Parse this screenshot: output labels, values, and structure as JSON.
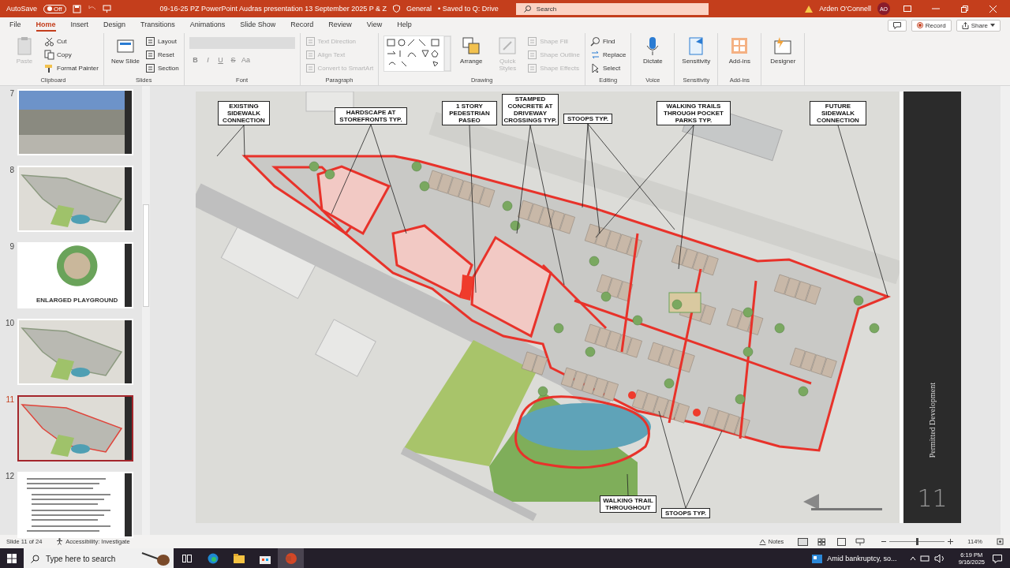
{
  "title_bar": {
    "autosave_label": "AutoSave",
    "autosave": {
      "label": "Off",
      "on": false
    },
    "filename": "09-16-25 PZ PowerPoint Audras presentation 13 September 2025 P & Z",
    "sensitivity": "General",
    "save_status": "• Saved to Q: Drive",
    "search": {
      "placeholder": "Search"
    },
    "user": "Arden O'Connell",
    "avatar": "AO"
  },
  "tabs": [
    {
      "label": "File",
      "selected": false
    },
    {
      "label": "Home",
      "selected": true
    },
    {
      "label": "Insert",
      "selected": false
    },
    {
      "label": "Design",
      "selected": false
    },
    {
      "label": "Transitions",
      "selected": false
    },
    {
      "label": "Animations",
      "selected": false
    },
    {
      "label": "Slide Show",
      "selected": false
    },
    {
      "label": "Record",
      "selected": false
    },
    {
      "label": "Review",
      "selected": false
    },
    {
      "label": "View",
      "selected": false
    },
    {
      "label": "Help",
      "selected": false
    }
  ],
  "ribbon_actions": {
    "record": "Record",
    "share": "Share"
  },
  "ribbon": {
    "groups": [
      {
        "label": "Clipboard",
        "items": [
          {
            "label": "Paste",
            "kind": "large",
            "disabled": true
          },
          {
            "label": "Cut",
            "kind": "small",
            "disabled": false
          },
          {
            "label": "Copy",
            "kind": "small",
            "disabled": false
          },
          {
            "label": "Format Painter",
            "kind": "small",
            "disabled": false
          }
        ]
      },
      {
        "label": "Slides",
        "items": [
          {
            "label": "New Slide",
            "kind": "large",
            "disabled": false
          },
          {
            "label": "Layout",
            "kind": "small",
            "disabled": false
          },
          {
            "label": "Reset",
            "kind": "small",
            "disabled": false
          },
          {
            "label": "Section",
            "kind": "small",
            "disabled": false
          }
        ]
      },
      {
        "label": "Font",
        "items": [
          {
            "kind": "field",
            "disabled": true
          },
          {
            "label": "B",
            "kind": "glyph",
            "disabled": true
          },
          {
            "label": "I",
            "kind": "glyph",
            "disabled": true
          },
          {
            "label": "U",
            "kind": "glyph",
            "disabled": true
          },
          {
            "label": "S",
            "kind": "glyph",
            "disabled": true
          },
          {
            "label": "Aa",
            "kind": "glyph",
            "disabled": true
          }
        ]
      },
      {
        "label": "Paragraph",
        "items": [
          {
            "label": "Text Direction",
            "kind": "small",
            "disabled": true
          },
          {
            "label": "Align Text",
            "kind": "small",
            "disabled": true
          },
          {
            "label": "Convert to SmartArt",
            "kind": "small",
            "disabled": true
          }
        ]
      },
      {
        "label": "Drawing",
        "items": [
          {
            "kind": "gallery",
            "disabled": false
          },
          {
            "label": "Arrange",
            "kind": "large",
            "disabled": false
          },
          {
            "label": "Quick Styles",
            "kind": "large",
            "disabled": true
          },
          {
            "label": "Shape Fill",
            "kind": "small",
            "disabled": true
          },
          {
            "label": "Shape Outline",
            "kind": "small",
            "disabled": true
          },
          {
            "label": "Shape Effects",
            "kind": "small",
            "disabled": true
          }
        ]
      },
      {
        "label": "Editing",
        "items": [
          {
            "label": "Find",
            "kind": "small",
            "disabled": false
          },
          {
            "label": "Replace",
            "kind": "small",
            "disabled": false
          },
          {
            "label": "Select",
            "kind": "small",
            "disabled": false
          }
        ]
      },
      {
        "label": "Voice",
        "items": [
          {
            "label": "Dictate",
            "kind": "large",
            "disabled": false
          }
        ]
      },
      {
        "label": "Sensitivity",
        "items": [
          {
            "label": "Sensitivity",
            "kind": "large",
            "disabled": false
          }
        ]
      },
      {
        "label": "Add-ins",
        "items": [
          {
            "label": "Add-ins",
            "kind": "large",
            "disabled": false
          }
        ]
      },
      {
        "items": [
          {
            "label": "Designer",
            "kind": "large",
            "disabled": false
          }
        ]
      }
    ]
  },
  "thumbnails": [
    {
      "number": "7",
      "kind": "rendering",
      "selected": false
    },
    {
      "number": "8",
      "kind": "site-plan",
      "selected": false
    },
    {
      "number": "9",
      "kind": "playground",
      "selected": false,
      "caption": "ENLARGED PLAYGROUND"
    },
    {
      "number": "10",
      "kind": "site-plan",
      "selected": false
    },
    {
      "number": "11",
      "kind": "site-plan",
      "selected": true
    },
    {
      "number": "12",
      "kind": "text",
      "selected": false
    }
  ],
  "slide": {
    "callouts": [
      "EXISTING SIDEWALK CONNECTION",
      "HARDSCAPE AT STOREFRONTS TYP.",
      "1 STORY PEDESTRIAN PASEO",
      "STAMPED CONCRETE AT DRIVEWAY CROSSINGS TYP.",
      "STOOPS TYP.",
      "WALKING TRAILS THROUGH POCKET PARKS TYP.",
      "FUTURE SIDEWALK CONNECTION",
      "WALKING TRAIL THROUGHOUT",
      "STOOPS TYP."
    ],
    "side_title": "Permitted Development",
    "number": "11"
  },
  "status_bar": {
    "slide_info": "Slide 11 of 24",
    "accessibility": "Accessibility: Investigate",
    "notes": "Notes",
    "zoom": {
      "label": "114%",
      "level": 0.5
    }
  },
  "taskbar": {
    "search": {
      "placeholder": "Type here to search"
    },
    "news": "Amid bankruptcy, so...",
    "time": "6:19 PM",
    "date": "9/16/2025"
  }
}
